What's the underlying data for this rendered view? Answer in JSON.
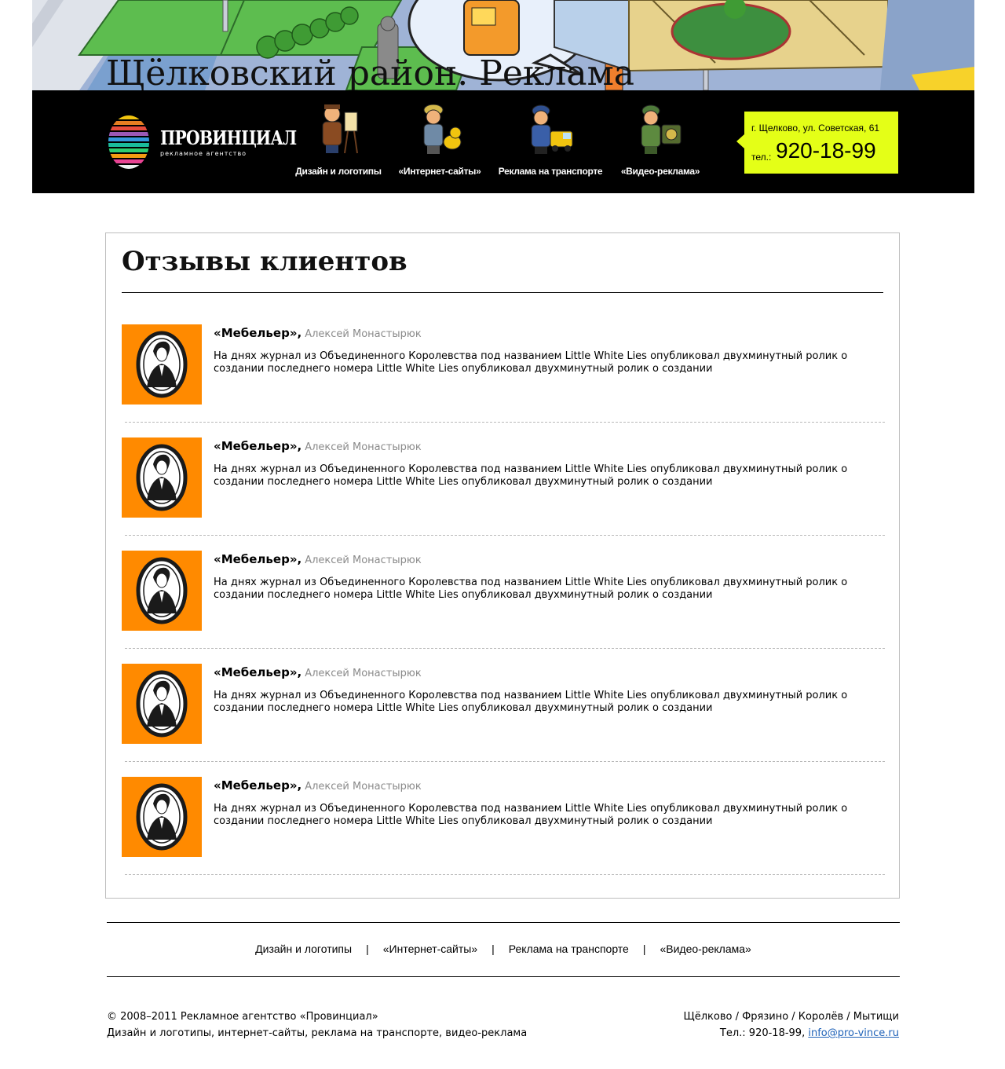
{
  "banner": {
    "title": "Щёлковский район. Реклама"
  },
  "header": {
    "logo": {
      "name": "ПРОВИНЦИАЛ",
      "subtitle": "рекламное агентство"
    },
    "nav": [
      {
        "label": "Дизайн и логотипы",
        "icon": "painter-figure-icon"
      },
      {
        "label": "«Интернет-сайты»",
        "icon": "builder-with-dog-figure-icon"
      },
      {
        "label": "Реклама на транспорте",
        "icon": "driver-with-truck-figure-icon"
      },
      {
        "label": "«Видео-реклама»",
        "icon": "soldier-with-camera-figure-icon"
      }
    ],
    "contact": {
      "address": "г. Щелково, ул. Советская, 61",
      "phone_label": "тел.:",
      "phone": "920-18-99",
      "background": "#e4ff17"
    }
  },
  "reviews": {
    "title": "Отзывы клиентов",
    "items": [
      {
        "company": "«Мебельер»,",
        "author": "Алексей Монастырюк",
        "text": "На днях журнал из Объединенного Королевства под названием Little White Lies опубликовал двухминутный ролик о создании последнего номера Little White Lies опубликовал двухминутный ролик о создании"
      },
      {
        "company": "«Мебельер»,",
        "author": "Алексей Монастырюк",
        "text": "На днях журнал из Объединенного Королевства под названием Little White Lies опубликовал двухминутный ролик о создании последнего номера Little White Lies опубликовал двухминутный ролик о создании"
      },
      {
        "company": "«Мебельер»,",
        "author": "Алексей Монастырюк",
        "text": "На днях журнал из Объединенного Королевства под названием Little White Lies опубликовал двухминутный ролик о создании последнего номера Little White Lies опубликовал двухминутный ролик о создании"
      },
      {
        "company": "«Мебельер»,",
        "author": "Алексей Монастырюк",
        "text": "На днях журнал из Объединенного Королевства под названием Little White Lies опубликовал двухминутный ролик о создании последнего номера Little White Lies опубликовал двухминутный ролик о создании"
      },
      {
        "company": "«Мебельер»,",
        "author": "Алексей Монастырюк",
        "text": "На днях журнал из Объединенного Королевства под названием Little White Lies опубликовал двухминутный ролик о создании последнего номера Little White Lies опубликовал двухминутный ролик о создании"
      }
    ],
    "photo_background": "#ff8a00"
  },
  "footer": {
    "nav": [
      {
        "label": "Дизайн и логотипы"
      },
      {
        "label": "«Интернет-сайты»"
      },
      {
        "label": "Реклама на транспорте"
      },
      {
        "label": "«Видео-реклама»"
      }
    ],
    "nav_separator": "|",
    "copyright": "© 2008–2011 Рекламное агентство «Провинциал»",
    "services": "Дизайн и логотипы, интернет-сайты, реклама на транспорте, видео-реклама",
    "cities": "Щёлково / Фрязино / Королёв / Мытищи",
    "phone_line": "Тел.: 920-18-99,",
    "email": "info@pro-vince.ru",
    "link_color": "#1f62b8"
  }
}
